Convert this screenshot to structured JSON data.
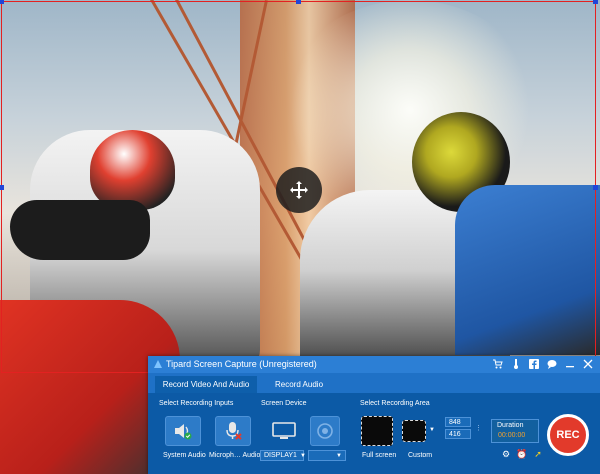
{
  "app": {
    "title": "Tipard Screen Capture (Unregistered)",
    "tabs": [
      {
        "label": "Record Video And Audio",
        "active": true
      },
      {
        "label": "Record Audio",
        "active": false
      }
    ],
    "titlebar_icons": [
      "cart-icon",
      "thermometer-icon",
      "facebook-icon",
      "chat-icon",
      "minimize-icon",
      "close-icon"
    ]
  },
  "sections": {
    "inputs_label": "Select Recording Inputs",
    "device_label": "Screen Device",
    "area_label": "Select Recording Area"
  },
  "inputs": {
    "system_audio": "System Audio",
    "microphone_audio": "Microph… Audio)"
  },
  "device": {
    "display_value": "DISPLAY1"
  },
  "area": {
    "full_screen": "Full screen",
    "custom": "Custom",
    "width": "848",
    "height": "416"
  },
  "duration": {
    "label": "Duration",
    "value": "00:00:00"
  },
  "rec_label": "REC",
  "colors": {
    "selection_border": "#e32121",
    "window_bg": "#0e5fab",
    "rec": "#e23a2b",
    "duration_value": "#f0a030"
  }
}
